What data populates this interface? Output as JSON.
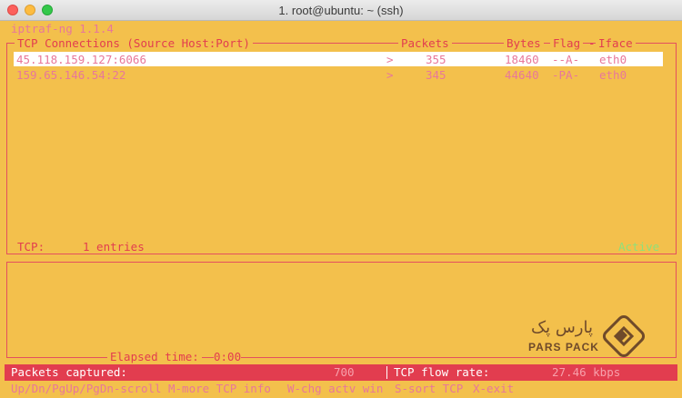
{
  "window": {
    "title": "1. root@ubuntu: ~ (ssh)"
  },
  "app": {
    "version_line": "iptraf-ng 1.1.4"
  },
  "headers": {
    "connections": "TCP Connections (Source Host:Port)",
    "packets": "Packets",
    "bytes": "Bytes",
    "flag": "Flag",
    "iface": "Iface"
  },
  "rows": [
    {
      "host": "45.118.159.127:6066",
      "arrow": ">",
      "packets": "355",
      "bytes": "18460",
      "flag": "--A-",
      "iface": "eth0"
    },
    {
      "host": "159.65.146.54:22",
      "arrow": ">",
      "packets": "345",
      "bytes": "44640",
      "flag": "-PA-",
      "iface": "eth0"
    }
  ],
  "summary": {
    "tcp_label": "TCP:",
    "entries": "1 entries",
    "state": "Active"
  },
  "elapsed": {
    "label": "Elapsed time:",
    "value": "0:00"
  },
  "status": {
    "packets_label": "Packets captured:",
    "packets_value": "700",
    "flow_label": "TCP flow rate:",
    "flow_value": "27.46 kbps"
  },
  "keys": [
    "Up/Dn/PgUp/PgDn-scroll",
    "M-more TCP info",
    "W-chg actv win",
    "S-sort TCP",
    "X-exit"
  ],
  "logo": {
    "text_fa": "پارس پک",
    "text_en": "PARS PACK"
  },
  "colors": {
    "background": "#f3c04c",
    "border": "#e4505e",
    "text_pink": "#e8779a",
    "status_bar": "#e23d4f",
    "active": "#8fe07a"
  }
}
